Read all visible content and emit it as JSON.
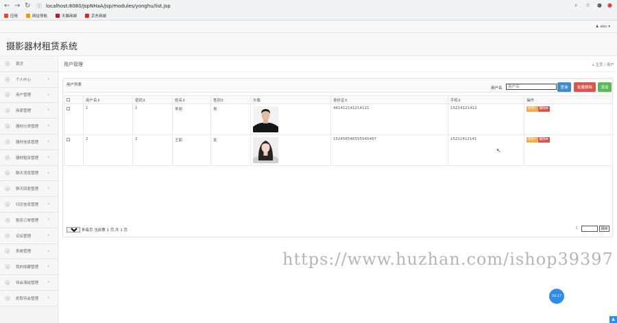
{
  "browser": {
    "url": "localhost:8080/jspNHaA/jsp/modules/yonghu/list.jsp",
    "bookmarks": [
      {
        "label": "应用",
        "color": "#e94235"
      },
      {
        "label": "网址导航",
        "color": "#f29900"
      },
      {
        "label": "天猫商城",
        "color": "#c4161c"
      },
      {
        "label": "京东商城",
        "color": "#e1251b"
      }
    ]
  },
  "topbar": {
    "user": "abo"
  },
  "header": {
    "title": "摄影器材租赁系统"
  },
  "sidebar": {
    "items": [
      {
        "label": "首页",
        "icon": "home-icon",
        "chevron": false
      },
      {
        "label": "个人中心",
        "icon": "user-icon",
        "chevron": true
      },
      {
        "label": "用户管理",
        "icon": "list-icon",
        "chevron": true
      },
      {
        "label": "商家管理",
        "icon": "list-icon",
        "chevron": true
      },
      {
        "label": "器材分类管理",
        "icon": "list-icon",
        "chevron": true
      },
      {
        "label": "器材信息管理",
        "icon": "list-icon",
        "chevron": true
      },
      {
        "label": "器材租赁管理",
        "icon": "list-icon",
        "chevron": true
      },
      {
        "label": "聊天消息管理",
        "icon": "list-icon",
        "chevron": true
      },
      {
        "label": "聊天回复管理",
        "icon": "list-icon",
        "chevron": true
      },
      {
        "label": "归还信息管理",
        "icon": "list-icon",
        "chevron": true
      },
      {
        "label": "租赁订单管理",
        "icon": "list-icon",
        "chevron": true
      },
      {
        "label": "论坛管理",
        "icon": "list-icon",
        "chevron": true
      },
      {
        "label": "系统管理",
        "icon": "list-icon",
        "chevron": true
      },
      {
        "label": "我的收藏管理",
        "icon": "list-icon",
        "chevron": true
      },
      {
        "label": "待会清结管理",
        "icon": "list-icon",
        "chevron": true
      },
      {
        "label": "拒取待会管理",
        "icon": "list-icon",
        "chevron": true
      }
    ]
  },
  "page": {
    "title": "用户管理",
    "breadcrumb": "主页 / 用户"
  },
  "panel": {
    "heading": "用户列表",
    "search_label": "用户名",
    "search_placeholder": "用户名",
    "search_button": "查询",
    "batch_delete_button": "批量删除",
    "add_button": "添加"
  },
  "table": {
    "headers": [
      "",
      "用户名⇕",
      "密码⇕",
      "姓名⇕",
      "性别⇕",
      "头像",
      "身份证⇕",
      "手机⇕",
      "操作"
    ],
    "rows": [
      {
        "username": "1",
        "password": "1",
        "name": "李旭",
        "gender": "男",
        "id_card": "441412141214121",
        "phone": "15214121412",
        "avatar": "male-portrait"
      },
      {
        "username": "2",
        "password": "2",
        "name": "王丽",
        "gender": "女",
        "id_card": "152456546555545487",
        "phone": "15211412141",
        "avatar": "female-portrait"
      }
    ],
    "edit_label": "修改",
    "delete_label": "删除"
  },
  "pagination": {
    "page_size": "10",
    "summary": "条每页 当前第 1 页,共 1 页",
    "current_page": "1",
    "go_label": "跳转"
  },
  "watermark": "https://www.huzhan.com/ishop39397",
  "timer": "00:17"
}
